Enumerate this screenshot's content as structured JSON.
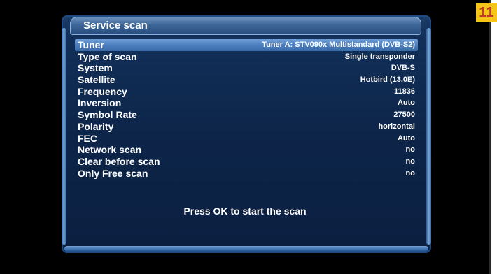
{
  "badge": "11",
  "dialog": {
    "title": "Service scan"
  },
  "settings": [
    {
      "label": "Tuner",
      "value": "Tuner A: STV090x Multistandard (DVB-S2)",
      "selected": true
    },
    {
      "label": "Type of scan",
      "value": "Single transponder"
    },
    {
      "label": "System",
      "value": "DVB-S"
    },
    {
      "label": "Satellite",
      "value": "Hotbird (13.0E)"
    },
    {
      "label": "Frequency",
      "value": "11836"
    },
    {
      "label": "Inversion",
      "value": "Auto"
    },
    {
      "label": "Symbol Rate",
      "value": "27500"
    },
    {
      "label": "Polarity",
      "value": "horizontal"
    },
    {
      "label": "FEC",
      "value": "Auto"
    },
    {
      "label": "Network scan",
      "value": "no"
    },
    {
      "label": "Clear before scan",
      "value": "no"
    },
    {
      "label": "Only Free scan",
      "value": "no"
    }
  ],
  "hint": "Press OK to start the scan",
  "colors": {
    "background": "#000000",
    "dialog": "#0d2549",
    "selection": "#4c7fc0",
    "text": "#ffffff",
    "badge": "#f5c518",
    "badge_text": "#c0392b"
  }
}
